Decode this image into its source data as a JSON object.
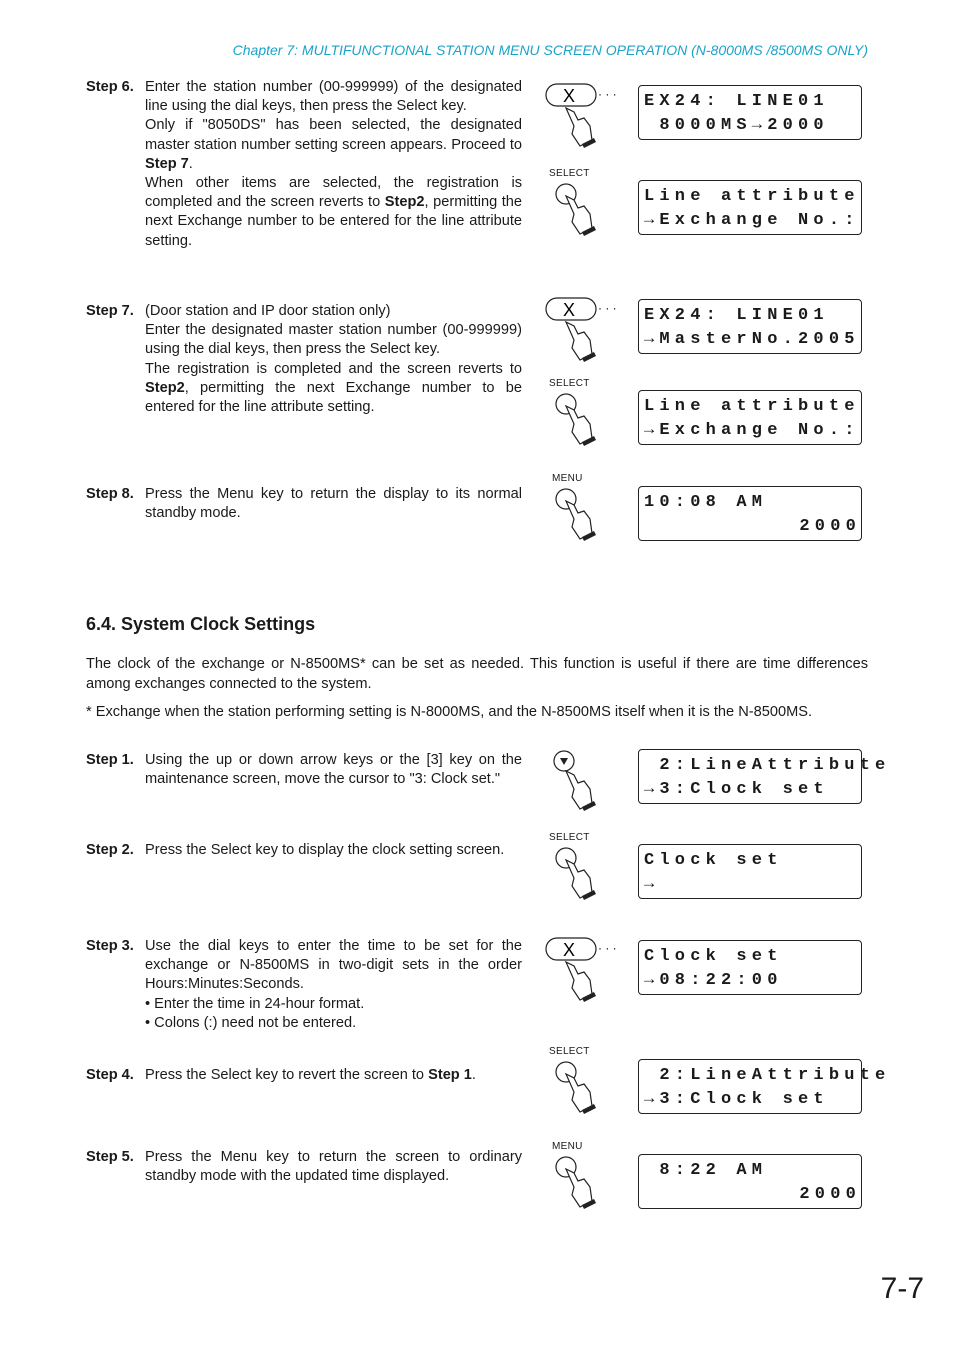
{
  "header": "Chapter 7:  MULTIFUNCTIONAL STATION MENU SCREEN OPERATION (N-8000MS /8500MS ONLY)",
  "top_steps": [
    {
      "label": "Step 6.",
      "lines": [
        "Enter the station number (00-999999) of the designated line using the dial keys, then press  the Select key.",
        "Only if \"8050DS\" has been selected, the designated master station number setting screen appears. Proceed to ",
        "When other items are selected, the registration is completed and the screen reverts to ",
        ", permitting the next Exchange number to be entered for the line attribute setting."
      ],
      "bold_a": "Step 7",
      "bold_b": "Step2"
    },
    {
      "label": "Step 7.",
      "lines": [
        "(Door station and IP door station only)",
        "Enter the designated master station number (00-999999) using the dial keys, then press the Select key.",
        "The registration is completed and the screen reverts to ",
        ", permitting the next Exchange number to be entered for the line attribute setting."
      ],
      "bold_a": "Step2"
    },
    {
      "label": "Step 8.",
      "lines": [
        "Press the Menu key to return the display to its normal standby mode."
      ]
    }
  ],
  "section": {
    "title": "6.4. System Clock Settings",
    "intro": "The clock of the exchange or N-8500MS* can be set as needed. This function is useful if there are time differences among exchanges connected to the system.",
    "footnote": "* Exchange when the station performing setting is N-8000MS, and the N-8500MS itself when it is the N-8500MS."
  },
  "clock_steps": [
    {
      "label": "Step 1.",
      "text": "Using the up or down arrow keys or the [3] key on the maintenance screen, move the cursor to \"3: Clock set.\""
    },
    {
      "label": "Step 2.",
      "text": "Press the Select key to display the clock setting screen."
    },
    {
      "label": "Step 3.",
      "text": "Use the dial keys to enter the time to be set for the exchange or N-8500MS in two-digit sets in the order Hours:Minutes:Seconds.",
      "bullets": [
        "Enter the time in 24-hour format.",
        "Colons (:) need not be entered."
      ]
    },
    {
      "label": "Step 4.",
      "text": "Press the Select key to revert the screen to ",
      "bold": "Step 1",
      "tail": "."
    },
    {
      "label": "Step 5.",
      "text": "Press the Menu key to return the screen to ordinary standby mode with the updated time displayed."
    }
  ],
  "keys": {
    "select": "SELECT",
    "menu": "MENU",
    "dial": "X",
    "dots": "· · ·"
  },
  "lcds": [
    {
      "l1": "EX24: LINE01",
      "l2": " 8000MS→2000"
    },
    {
      "l1": "Line attribute",
      "l2": "→Exchange No.:"
    },
    {
      "l1": "EX24: LINE01",
      "l2": "→MasterNo.2005"
    },
    {
      "l1": "Line attribute",
      "l2": "→Exchange No.:"
    },
    {
      "l1": "10:08 AM",
      "l2": "2000"
    },
    {
      "l1": " 2:LineAttribute",
      "l2": "→3:Clock set"
    },
    {
      "l1": "Clock set",
      "l2": "→"
    },
    {
      "l1": "Clock set",
      "l2": "→08:22:00"
    },
    {
      "l1": " 2:LineAttribute",
      "l2": "→3:Clock set"
    },
    {
      "l1": " 8:22 AM",
      "l2": "2000"
    }
  ],
  "page_number": "7-7"
}
